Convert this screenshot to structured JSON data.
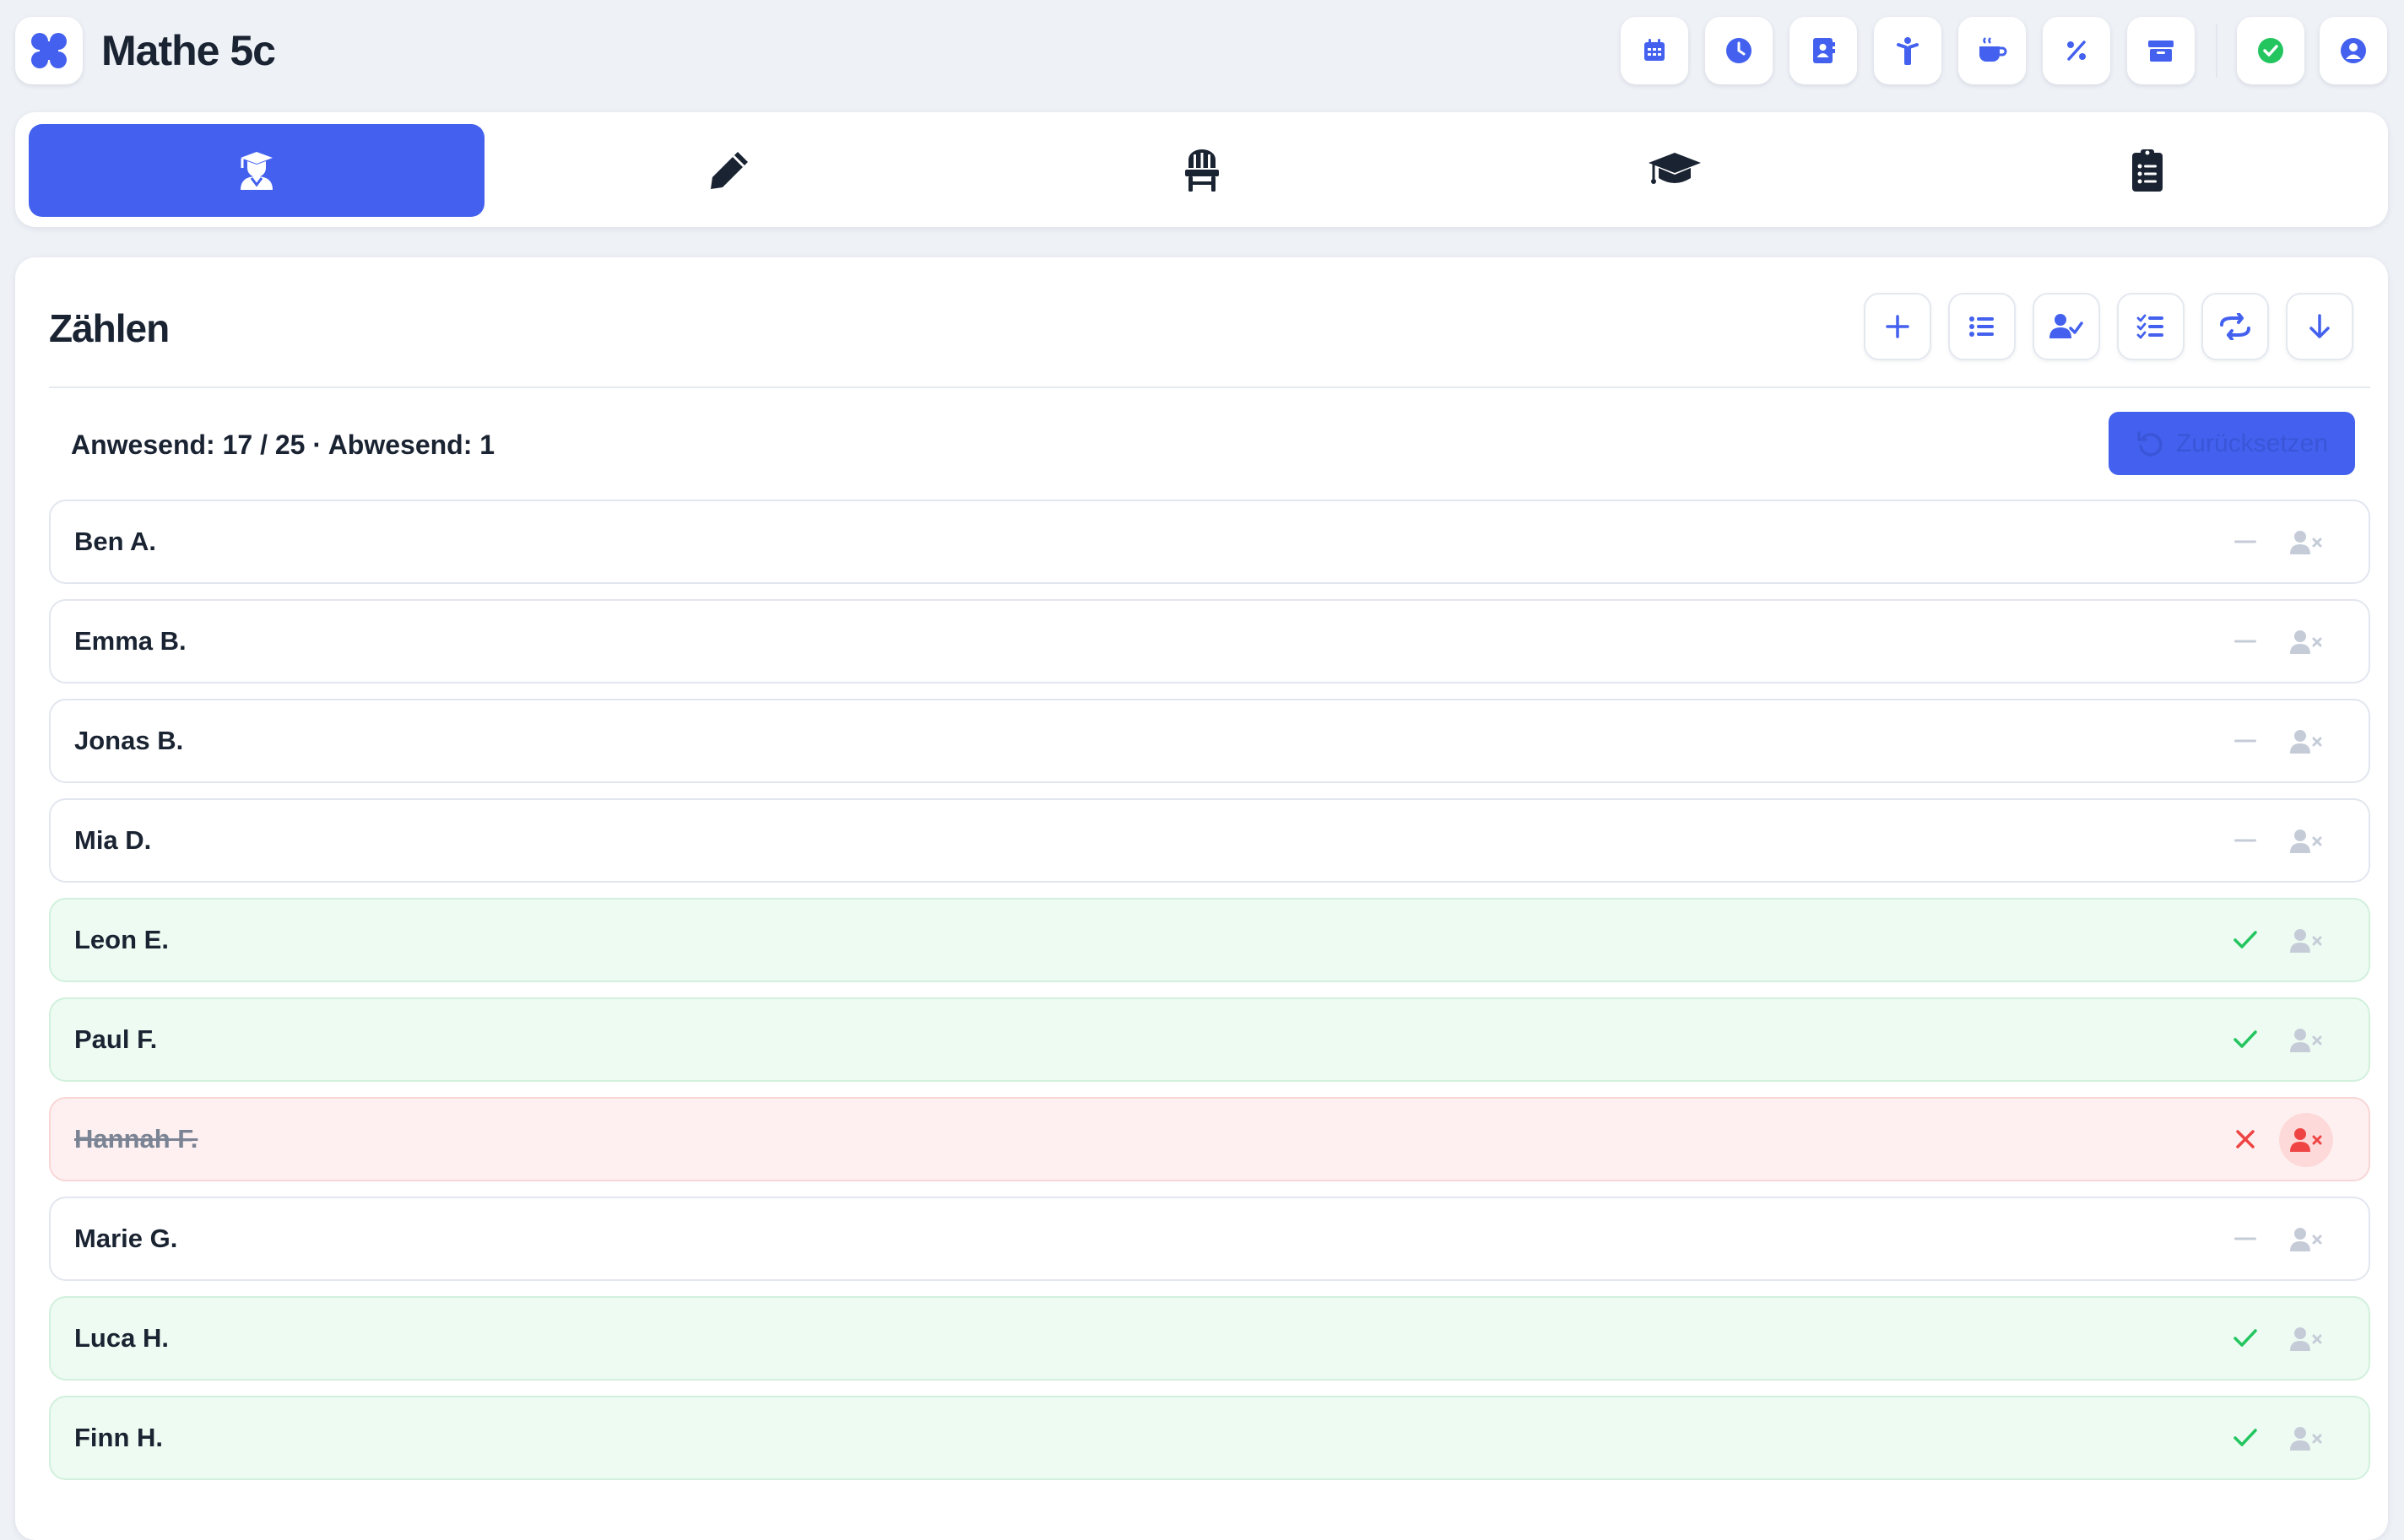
{
  "header": {
    "title": "Mathe 5c",
    "logo_icon": "four-dots-logo",
    "buttons": [
      "calendar-icon",
      "clock-icon",
      "contact-book-icon",
      "person-icon",
      "coffee-icon",
      "percent-icon",
      "archive-icon",
      "check-circle-icon",
      "user-circle-icon"
    ]
  },
  "tabs": [
    {
      "icon": "student-icon",
      "active": true
    },
    {
      "icon": "pencil-icon",
      "active": false
    },
    {
      "icon": "chair-icon",
      "active": false
    },
    {
      "icon": "graduation-cap-icon",
      "active": false
    },
    {
      "icon": "clipboard-list-icon",
      "active": false
    }
  ],
  "card": {
    "title": "Zählen",
    "actions": [
      "plus-icon",
      "list-icon",
      "user-check-icon",
      "checklist-icon",
      "swap-icon",
      "arrow-down-icon"
    ],
    "summary": "Anwesend: 17 / 25 · Abwesend: 1",
    "reset_label": "Zurücksetzen"
  },
  "students": [
    {
      "name": "Ben A.",
      "status": "none"
    },
    {
      "name": "Emma B.",
      "status": "none"
    },
    {
      "name": "Jonas B.",
      "status": "none"
    },
    {
      "name": "Mia D.",
      "status": "none"
    },
    {
      "name": "Leon E.",
      "status": "present"
    },
    {
      "name": "Paul F.",
      "status": "present"
    },
    {
      "name": "Hannah F.",
      "status": "absent"
    },
    {
      "name": "Marie G.",
      "status": "none"
    },
    {
      "name": "Luca H.",
      "status": "present"
    },
    {
      "name": "Finn H.",
      "status": "present"
    }
  ],
  "colors": {
    "accent": "#4361ee",
    "present": "#22c55e",
    "absent": "#ef4444",
    "muted": "#c5ccd8"
  }
}
